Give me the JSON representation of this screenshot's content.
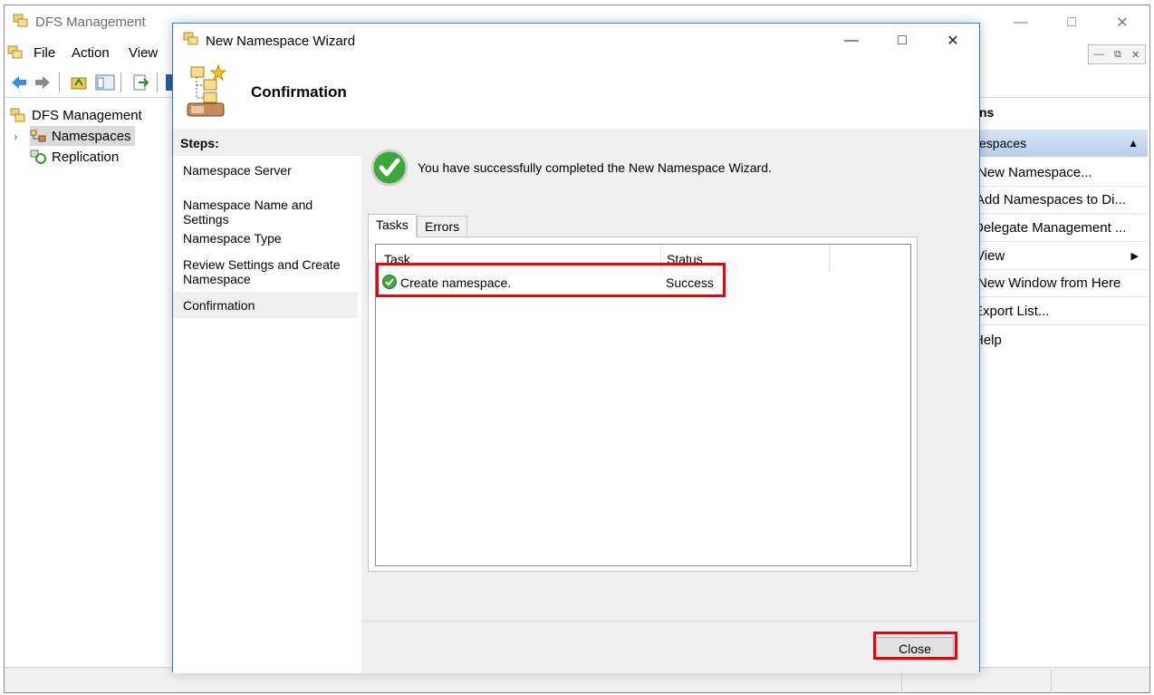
{
  "main": {
    "title": "DFS Management",
    "menu": [
      "File",
      "Action",
      "View"
    ],
    "tree": {
      "root": "DFS Management",
      "items": [
        "Namespaces",
        "Replication"
      ]
    },
    "actions": {
      "header": "ns",
      "section": "espaces",
      "items": [
        "New Namespace...",
        "Add Namespaces to Di...",
        "Delegate Management ...",
        "View",
        "New Window from Here",
        "Export List...",
        "Help"
      ]
    }
  },
  "wizard": {
    "title": "New Namespace Wizard",
    "page_title": "Confirmation",
    "steps_heading": "Steps:",
    "steps": [
      "Namespace Server",
      "Namespace Name and Settings",
      "Namespace Type",
      "Review Settings and Create Namespace",
      "Confirmation"
    ],
    "message": "You have successfully completed the New Namespace Wizard.",
    "tabs": [
      "Tasks",
      "Errors"
    ],
    "columns": [
      "Task",
      "Status"
    ],
    "tasks": [
      {
        "task": "Create namespace.",
        "status": "Success"
      }
    ],
    "close_label": "Close"
  },
  "colors": {
    "highlight": "#e8000b",
    "accent": "#2b79d0",
    "success": "#3aa83a"
  }
}
